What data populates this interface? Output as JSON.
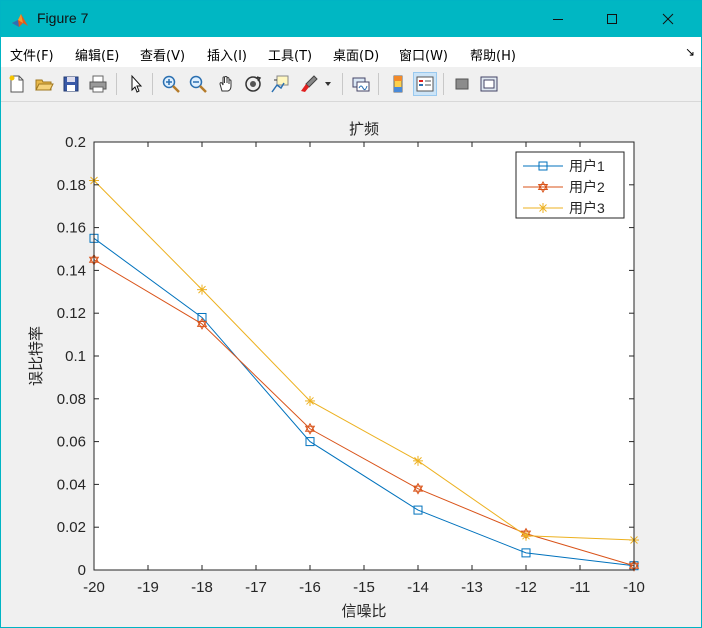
{
  "window": {
    "title": "Figure 7"
  },
  "menu": {
    "items": [
      "文件(F)",
      "编辑(E)",
      "查看(V)",
      "插入(I)",
      "工具(T)",
      "桌面(D)",
      "窗口(W)",
      "帮助(H)"
    ]
  },
  "toolbar": {
    "buttons": [
      "new-figure-icon",
      "open-file-icon",
      "save-icon",
      "print-icon",
      "pointer-icon",
      "zoom-in-icon",
      "zoom-out-icon",
      "pan-hand-icon",
      "rotate-3d-icon",
      "data-cursor-icon",
      "brush-icon",
      "link-plot-icon",
      "colorbar-icon",
      "legend-icon",
      "hide-plot-tools-icon",
      "show-plot-tools-icon"
    ]
  },
  "colors": {
    "titlebar": "#00b7c3",
    "series1": "#0072bd",
    "series2": "#d95319",
    "series3": "#edb120"
  },
  "chart_data": {
    "type": "line",
    "title": "扩频",
    "xlabel": "信噪比",
    "ylabel": "误比特率",
    "xlim": [
      -20,
      -10
    ],
    "ylim": [
      0,
      0.2
    ],
    "xticks": [
      "-20",
      "-19",
      "-18",
      "-17",
      "-16",
      "-15",
      "-14",
      "-13",
      "-12",
      "-11",
      "-10"
    ],
    "yticks": [
      "0",
      "0.02",
      "0.04",
      "0.06",
      "0.08",
      "0.1",
      "0.12",
      "0.14",
      "0.16",
      "0.18",
      "0.2"
    ],
    "x": [
      -20,
      -18,
      -16,
      -14,
      -12,
      -10
    ],
    "series": [
      {
        "name": "用户1",
        "marker": "square",
        "color": "#0072bd",
        "values": [
          0.155,
          0.118,
          0.06,
          0.028,
          0.008,
          0.002
        ]
      },
      {
        "name": "用户2",
        "marker": "hexagram",
        "color": "#d95319",
        "values": [
          0.145,
          0.115,
          0.066,
          0.038,
          0.017,
          0.002
        ]
      },
      {
        "name": "用户3",
        "marker": "asterisk",
        "color": "#edb120",
        "values": [
          0.182,
          0.131,
          0.079,
          0.051,
          0.016,
          0.014
        ]
      }
    ],
    "legend": {
      "position": "top-right"
    },
    "grid": false
  }
}
